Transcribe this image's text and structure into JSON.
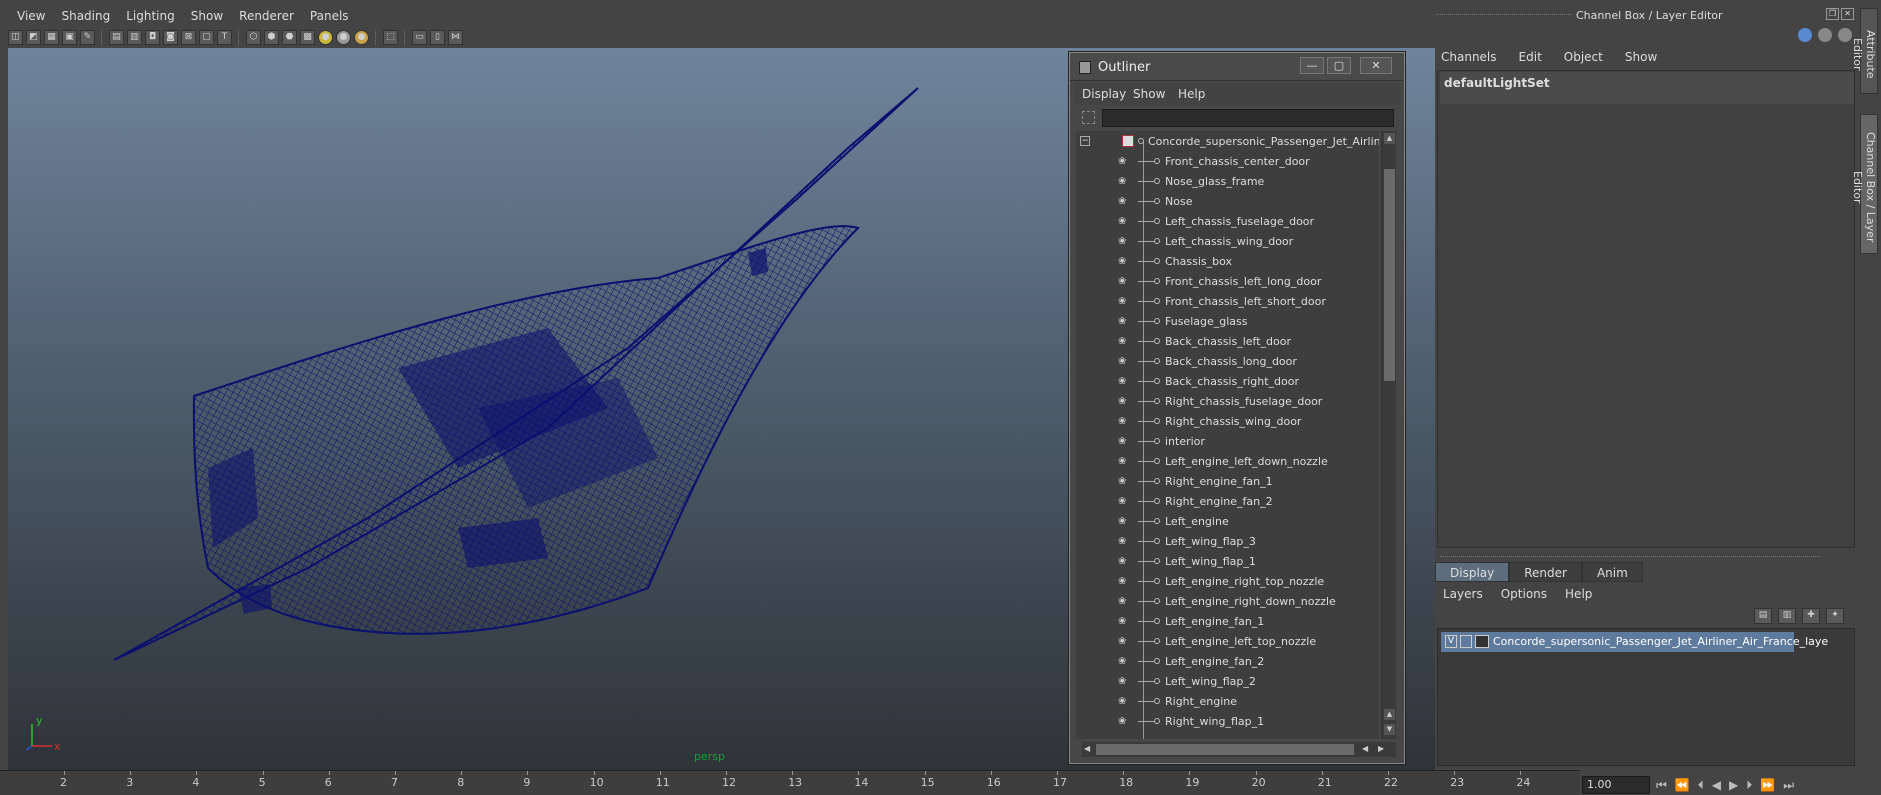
{
  "menubar": [
    "View",
    "Shading",
    "Lighting",
    "Show",
    "Renderer",
    "Panels"
  ],
  "viewport": {
    "camera_label": "persp",
    "axis_y": "y",
    "axis_x": "x"
  },
  "timeline": {
    "ticks": [
      "2",
      "3",
      "4",
      "5",
      "6",
      "7",
      "8",
      "9",
      "10",
      "11",
      "12",
      "13",
      "14",
      "15",
      "16",
      "17",
      "18",
      "19",
      "20",
      "21",
      "22",
      "23",
      "24"
    ],
    "current_time": "1.00"
  },
  "outliner": {
    "title": "Outliner",
    "menu": [
      "Display",
      "Show",
      "Help"
    ],
    "root": "Concorde_supersonic_Passenger_Jet_Airliner_A",
    "items": [
      "Front_chassis_center_door",
      "Nose_glass_frame",
      "Nose",
      "Left_chassis_fuselage_door",
      "Left_chassis_wing_door",
      "Chassis_box",
      "Front_chassis_left_long_door",
      "Front_chassis_left_short_door",
      "Fuselage_glass",
      "Back_chassis_left_door",
      "Back_chassis_long_door",
      "Back_chassis_right_door",
      "Right_chassis_fuselage_door",
      "Right_chassis_wing_door",
      "interior",
      "Left_engine_left_down_nozzle",
      "Right_engine_fan_1",
      "Right_engine_fan_2",
      "Left_engine",
      "Left_wing_flap_3",
      "Left_wing_flap_1",
      "Left_engine_right_top_nozzle",
      "Left_engine_right_down_nozzle",
      "Left_engine_fan_1",
      "Left_engine_left_top_nozzle",
      "Left_engine_fan_2",
      "Left_wing_flap_2",
      "Right_engine",
      "Right_wing_flap_1"
    ]
  },
  "channel_box": {
    "title": "Channel Box / Layer Editor",
    "menu": [
      "Channels",
      "Edit",
      "Object",
      "Show"
    ],
    "selected_set": "defaultLightSet",
    "side_tabs": [
      "Attribute Editor",
      "Channel Box / Layer Editor"
    ]
  },
  "layer_editor": {
    "tabs": [
      "Display",
      "Render",
      "Anim"
    ],
    "menu": [
      "Layers",
      "Options",
      "Help"
    ],
    "layer_visible": "V",
    "layer_name": "Concorde_supersonic_Passenger_Jet_Airliner_Air_France_laye"
  },
  "colors": {
    "wireframe": "#0b0f6e",
    "selection": "#5e7b9d",
    "camera_label": "#17a037"
  }
}
